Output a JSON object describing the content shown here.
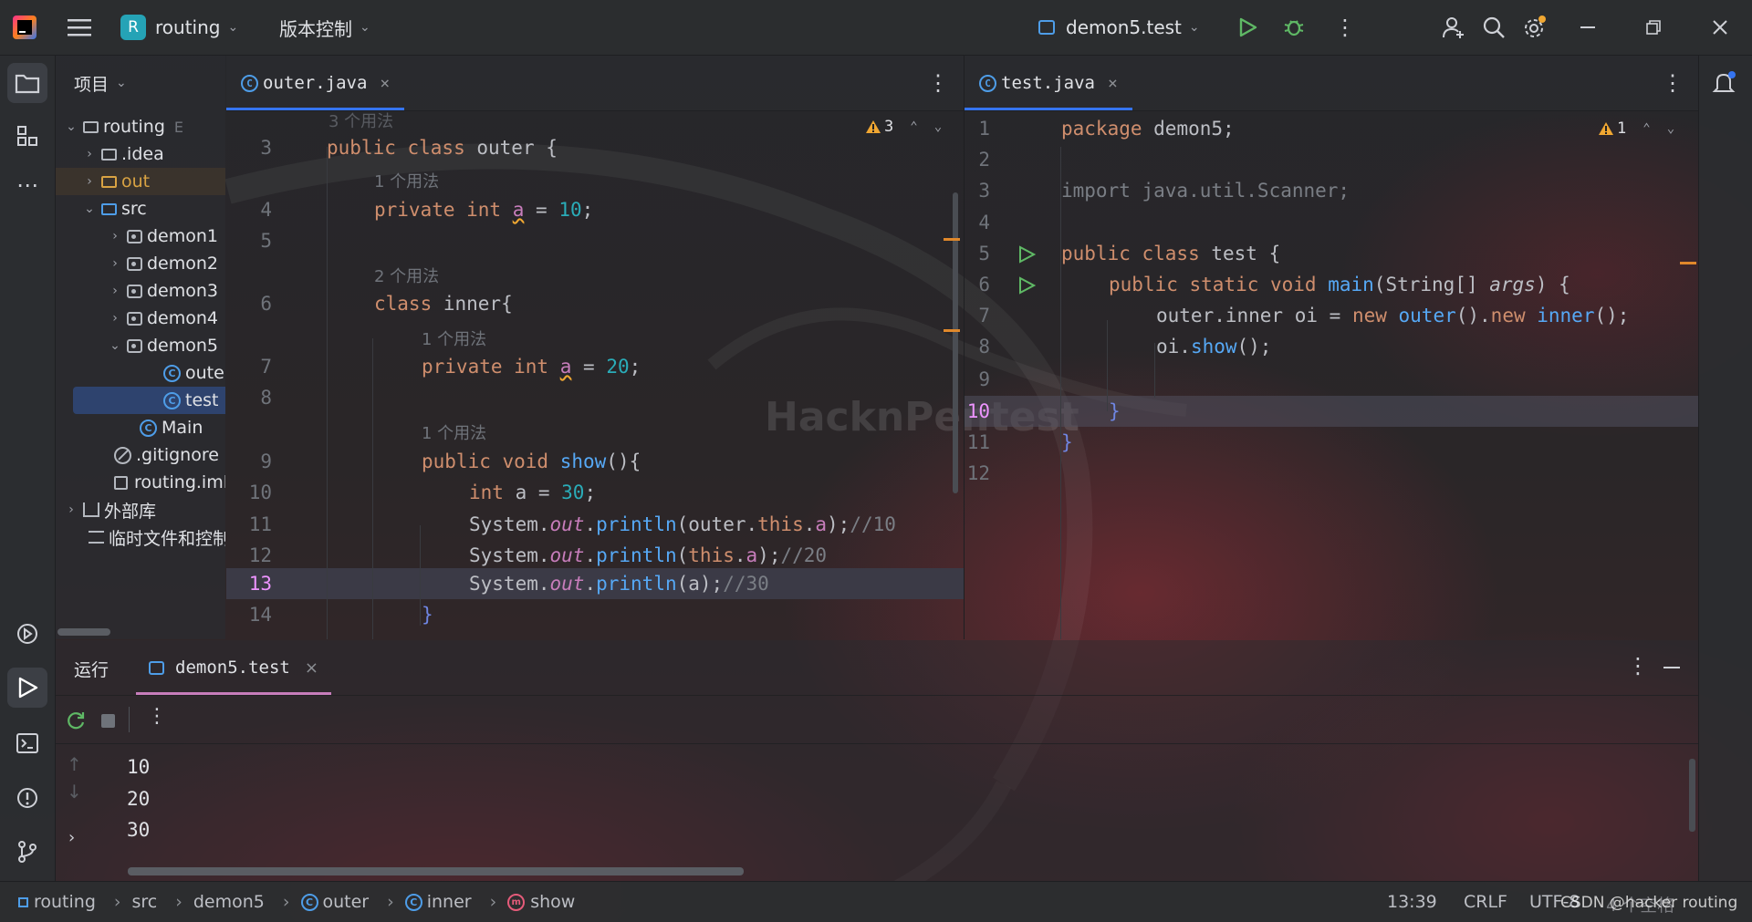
{
  "title_bar": {
    "project_badge": "R",
    "project_name": "routing",
    "vcs_label": "版本控制",
    "run_config": "demon5.test"
  },
  "project_panel": {
    "title": "项目",
    "tree": [
      {
        "label": "routing",
        "suffix": "E"
      },
      {
        "label": ".idea"
      },
      {
        "label": "out"
      },
      {
        "label": "src"
      },
      {
        "label": "demon1"
      },
      {
        "label": "demon2"
      },
      {
        "label": "demon3"
      },
      {
        "label": "demon4"
      },
      {
        "label": "demon5"
      },
      {
        "label": "outer"
      },
      {
        "label": "test"
      },
      {
        "label": "Main"
      },
      {
        "label": ".gitignore"
      },
      {
        "label": "routing.iml"
      },
      {
        "label": "外部库"
      },
      {
        "label": "临时文件和控制台"
      }
    ]
  },
  "editor_left": {
    "tab": "outer.java",
    "warnings": "3",
    "hint_3": "3 个用法",
    "hint_1": "1 个用法",
    "hint_2": "2 个用法",
    "line_numbers": [
      "3",
      "4",
      "5",
      "6",
      "7",
      "8",
      "9",
      "10",
      "11",
      "12",
      "13",
      "14"
    ],
    "code": {
      "l3a": "public class ",
      "l3b": "outer",
      "l3c": " {",
      "l4a": "private int ",
      "l4b": "a",
      "l4c": " = ",
      "l4d": "10",
      "l4e": ";",
      "l6a": "class ",
      "l6b": "inner",
      "l6c": "{",
      "l7a": "private int ",
      "l7b": "a",
      "l7c": " = ",
      "l7d": "20",
      "l7e": ";",
      "l9a": "public void ",
      "l9b": "show",
      "l9c": "(){",
      "l10a": "int ",
      "l10b": "a = ",
      "l10c": "30",
      "l10d": ";",
      "l11a": "System.",
      "l11b": "out",
      "l11c": ".",
      "l11d": "println",
      "l11e": "(outer.",
      "l11f": "this",
      "l11g": ".",
      "l11h": "a",
      "l11i": ");",
      "l11j": "//10",
      "l12a": "System.",
      "l12b": "out",
      "l12c": ".",
      "l12d": "println",
      "l12e": "(",
      "l12f": "this",
      "l12g": ".",
      "l12h": "a",
      "l12i": ");",
      "l12j": "//20",
      "l13a": "System.",
      "l13b": "out",
      "l13c": ".",
      "l13d": "println",
      "l13e": "(a);",
      "l13f": "//30",
      "l14a": "}"
    }
  },
  "editor_right": {
    "tab": "test.java",
    "warnings": "1",
    "line_numbers": [
      "1",
      "2",
      "3",
      "4",
      "5",
      "6",
      "7",
      "8",
      "9",
      "10",
      "11",
      "12"
    ],
    "code": {
      "l1a": "package ",
      "l1b": "demon5",
      "l1c": ";",
      "l3a": "import java.util.Scanner;",
      "l5a": "public class ",
      "l5b": "test",
      "l5c": " {",
      "l6a": "public static void ",
      "l6b": "main",
      "l6c": "(String[] ",
      "l6d": "args",
      "l6e": ") {",
      "l7a": "outer.inner oi = ",
      "l7b": "new ",
      "l7c": "outer",
      "l7d": "().",
      "l7e": "new ",
      "l7f": "inner",
      "l7g": "();",
      "l8a": "oi.",
      "l8b": "show",
      "l8c": "();",
      "l10a": "}",
      "l11a": "}"
    }
  },
  "run_panel": {
    "label": "运行",
    "tab": "demon5.test",
    "output": [
      "10",
      "20",
      "30"
    ]
  },
  "status_bar": {
    "crumbs": [
      "routing",
      "src",
      "demon5",
      "outer",
      "inner",
      "show"
    ],
    "position": "13:39",
    "line_sep": "CRLF",
    "encoding": "UTF-8",
    "indent": "4 个空格",
    "watermark": "CSDN @hacker routing"
  },
  "background_watermark": "HacknPentest",
  "colors": {
    "keyword": "#cf8e6d",
    "function": "#56a8f5",
    "number": "#2aacb8",
    "field": "#c77dbb",
    "comment": "#7a7e85",
    "accent": "#3574f0"
  }
}
